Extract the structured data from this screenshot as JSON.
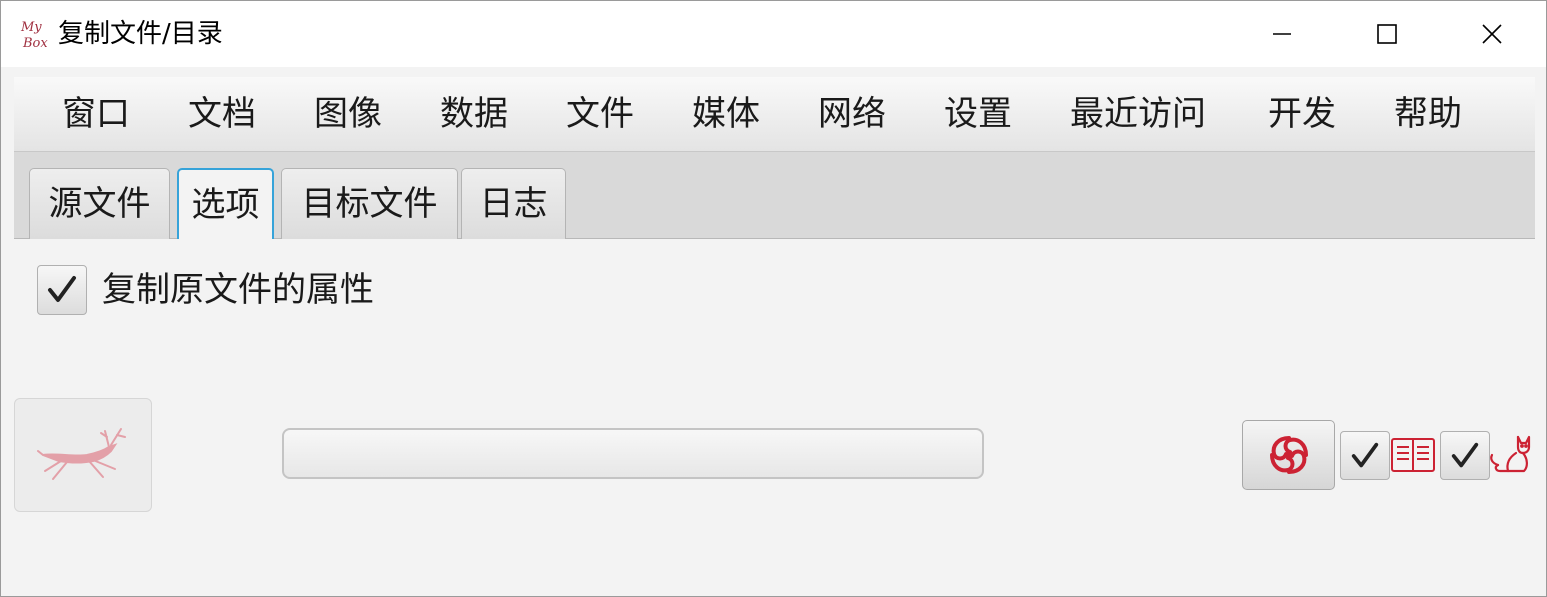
{
  "window": {
    "title": "复制文件/目录",
    "logo_text_top": "My",
    "logo_text_bottom": "Box"
  },
  "menu": {
    "items": [
      "窗口",
      "文档",
      "图像",
      "数据",
      "文件",
      "媒体",
      "网络",
      "设置",
      "最近访问",
      "开发",
      "帮助"
    ]
  },
  "tabs": {
    "items": [
      "源文件",
      "选项",
      "目标文件",
      "日志"
    ],
    "selected": "选项"
  },
  "options": {
    "copy_attributes_label": "复制原文件的属性",
    "copy_attributes_checked": true
  },
  "footer": {
    "run_button_icon": "running-deer-icon",
    "progress_value": 0,
    "tool_button_icon": "mybox-swirl-icon",
    "toggle1_checked": true,
    "toggle1_icon": "book-icon",
    "toggle2_checked": true,
    "toggle2_icon": "cat-icon"
  },
  "colors": {
    "accent_red": "#cc2233",
    "tab_focus": "#36a3d9",
    "background": "#f3f3f3"
  }
}
